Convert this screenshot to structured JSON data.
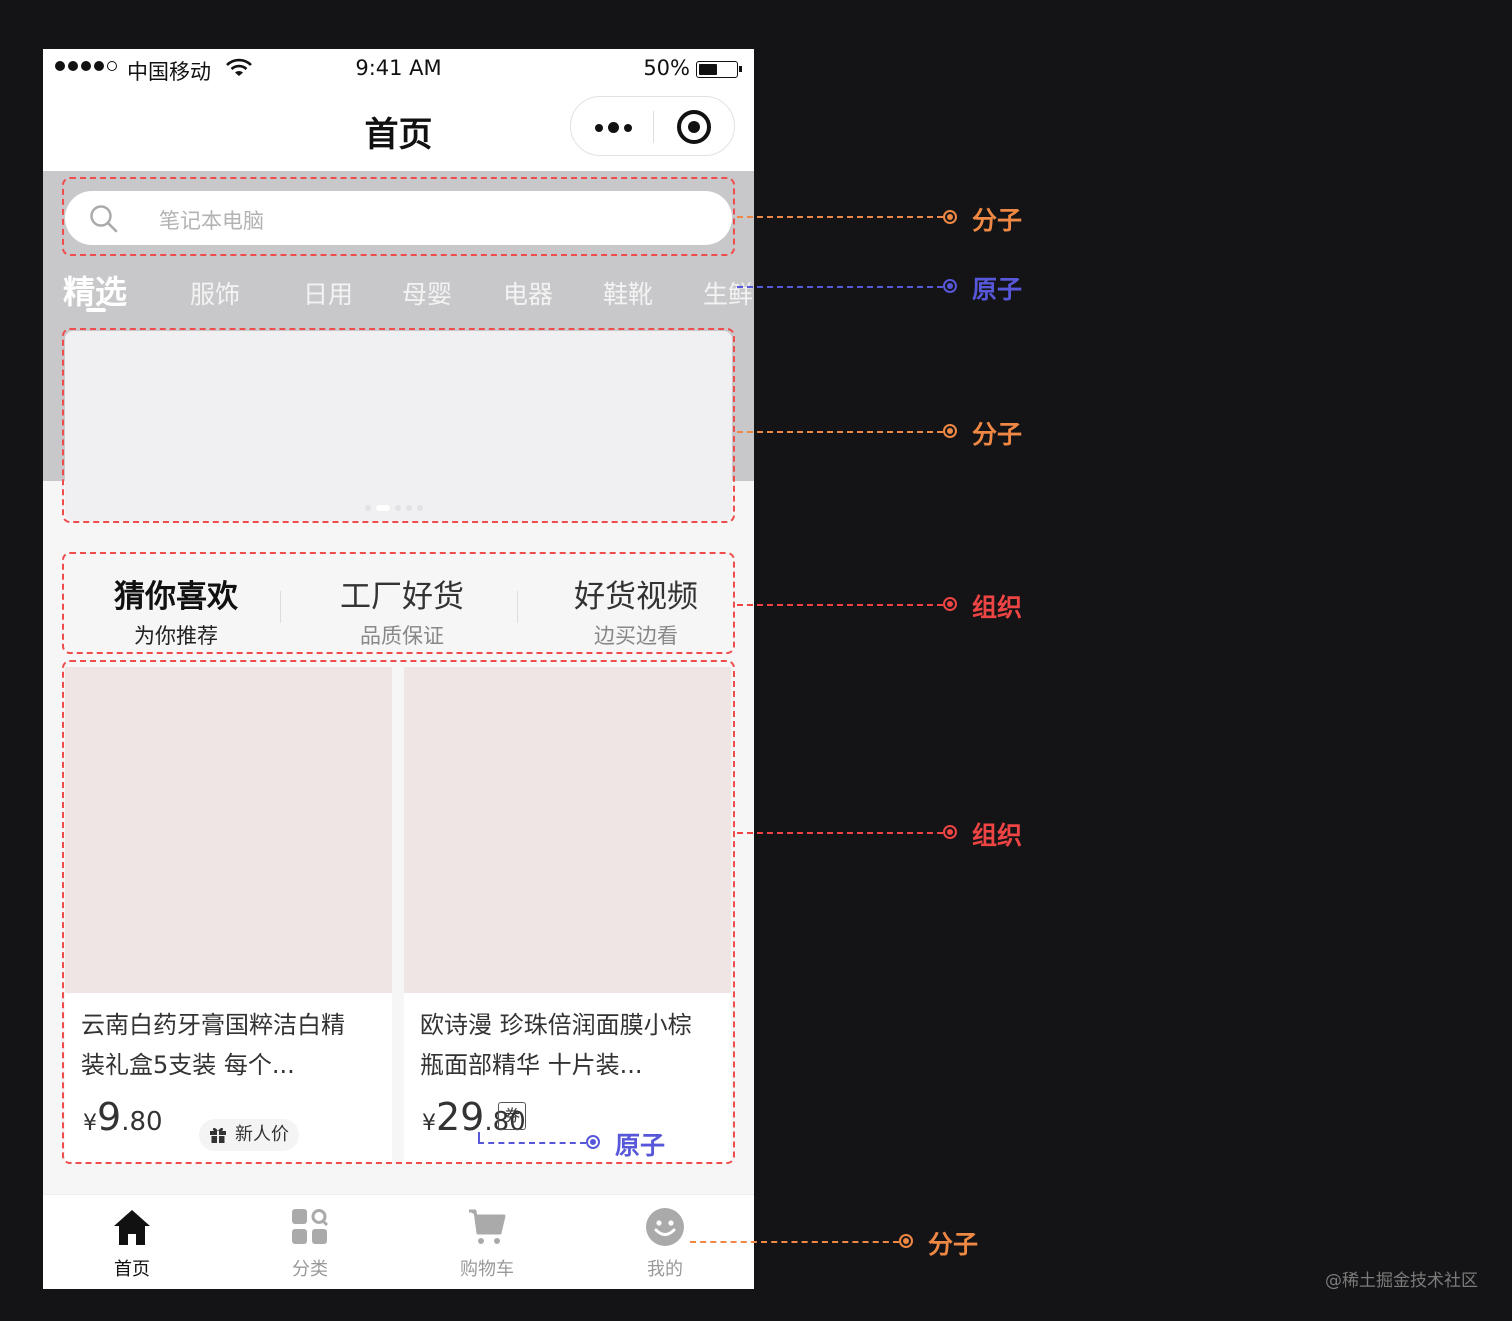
{
  "status_bar": {
    "carrier": "中国移动",
    "time": "9:41 AM",
    "battery": "50%",
    "battery_level": 0.5
  },
  "nav": {
    "title": "首页"
  },
  "search": {
    "placeholder": "笔记本电脑"
  },
  "tabs": [
    "精选",
    "服饰",
    "日用",
    "母婴",
    "电器",
    "鞋靴",
    "生鲜"
  ],
  "categories": [
    {
      "title": "猜你喜欢",
      "subtitle": "为你推荐"
    },
    {
      "title": "工厂好货",
      "subtitle": "品质保证"
    },
    {
      "title": "好货视频",
      "subtitle": "边买边看"
    }
  ],
  "products": [
    {
      "title": "云南白药牙膏国粹洁白精装礼盒5支装 每个...",
      "currency": "¥",
      "price_int": "9",
      "price_dec": ".80",
      "tag": "新人价"
    },
    {
      "title": "欧诗漫 珍珠倍润面膜小棕瓶面部精华 十片装...",
      "currency": "¥",
      "price_int": "29",
      "price_dec": ".80",
      "tag": "券"
    }
  ],
  "tabbar": [
    "首页",
    "分类",
    "购物车",
    "我的"
  ],
  "annotations": {
    "molecule": "分子",
    "atom": "原子",
    "organism": "组织"
  },
  "watermark": "@稀土掘金技术社区",
  "colors": {
    "molecule": "#ee8844",
    "atom": "#5757d9",
    "organism": "#ee4444",
    "outline": "#ef4c4c"
  }
}
